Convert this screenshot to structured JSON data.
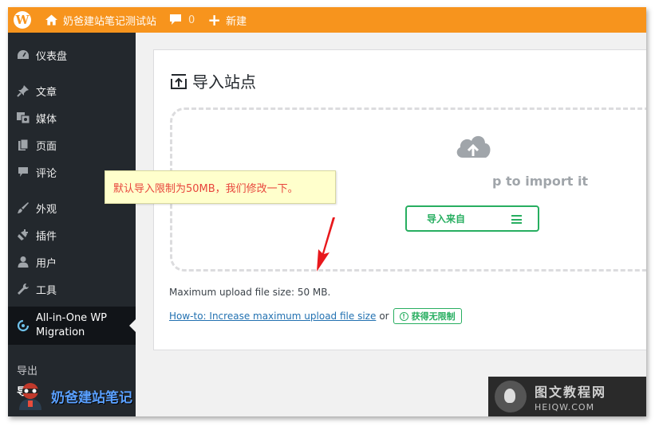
{
  "admin_bar": {
    "site_name": "奶爸建站笔记测试站",
    "comments_count": "0",
    "new_label": "新建"
  },
  "sidebar": {
    "items": [
      {
        "label": "仪表盘",
        "icon": "dashboard-icon"
      },
      {
        "label": "文章",
        "icon": "pin-icon"
      },
      {
        "label": "媒体",
        "icon": "media-icon"
      },
      {
        "label": "页面",
        "icon": "page-icon"
      },
      {
        "label": "评论",
        "icon": "comment-icon"
      },
      {
        "label": "外观",
        "icon": "brush-icon"
      },
      {
        "label": "插件",
        "icon": "plugin-icon"
      },
      {
        "label": "用户",
        "icon": "user-icon"
      },
      {
        "label": "工具",
        "icon": "wrench-icon"
      },
      {
        "label_line1": "All-in-One WP",
        "label_line2": "Migration",
        "icon": "migration-icon"
      }
    ],
    "submenu": [
      "导出",
      "导"
    ],
    "watermark_text": "奶爸建站笔记"
  },
  "main": {
    "title": "导入站点",
    "drop_text": "p to import it",
    "import_button": "导入来自",
    "tooltip": "默认导入限制为50MB，我们修改一下。",
    "max_upload": "Maximum upload file size: 50 MB.",
    "howto_link": "How-to: Increase maximum upload file size",
    "or_text": "or",
    "unlimited_button": "获得无限制"
  },
  "watermark": {
    "title": "图文教程网",
    "url": "HEIQW.COM"
  },
  "colors": {
    "admin_bar": "#f7941d",
    "sidebar": "#23282d",
    "accent_green": "#27ae60",
    "link": "#2271b1",
    "annotation_red": "#e8453c"
  }
}
